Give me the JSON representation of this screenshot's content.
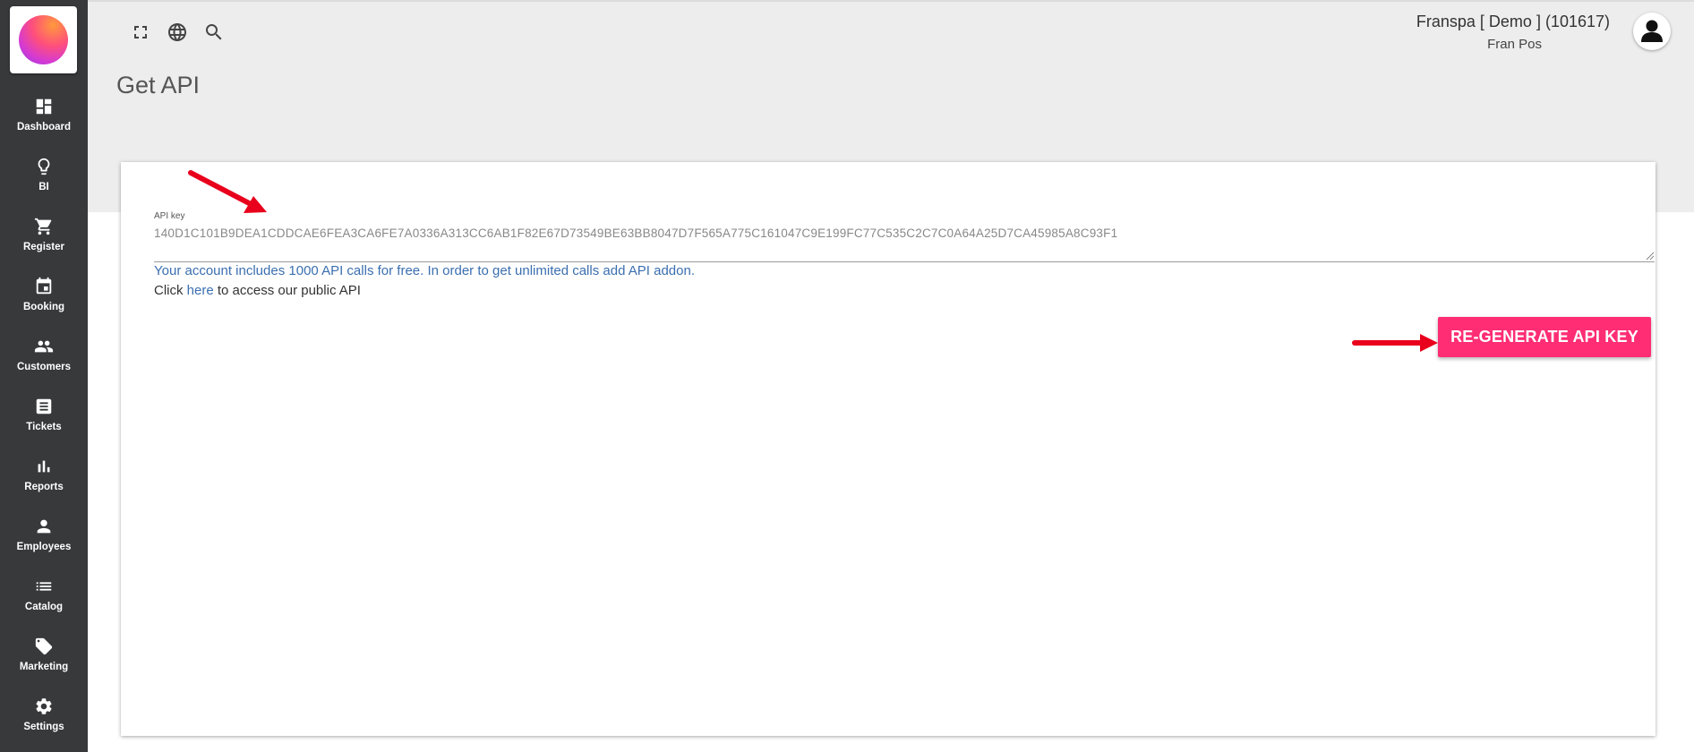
{
  "sidebar": {
    "logo": "company-logo",
    "items": [
      {
        "label": "Dashboard",
        "icon": "dashboard-icon"
      },
      {
        "label": "BI",
        "icon": "lightbulb-icon"
      },
      {
        "label": "Register",
        "icon": "cart-icon"
      },
      {
        "label": "Booking",
        "icon": "calendar-icon"
      },
      {
        "label": "Customers",
        "icon": "people-icon"
      },
      {
        "label": "Tickets",
        "icon": "receipt-icon"
      },
      {
        "label": "Reports",
        "icon": "bar-chart-icon"
      },
      {
        "label": "Employees",
        "icon": "person-icon"
      },
      {
        "label": "Catalog",
        "icon": "list-icon"
      },
      {
        "label": "Marketing",
        "icon": "tag-icon"
      },
      {
        "label": "Settings",
        "icon": "gear-icon"
      }
    ]
  },
  "header": {
    "title": "Get API",
    "tools": [
      "fullscreen-icon",
      "globe-icon",
      "search-icon"
    ],
    "account_name": "Franspa [ Demo ] (101617)",
    "account_sub": "Fran Pos"
  },
  "api": {
    "label": "API key",
    "key": "140D1C101B9DEA1CDDCAE6FEA3CA6FE7A0336A313CC6AB1F82E67D73549BE63BB8047D7F565A775C161047C9E199FC77C535C2C7C0A64A25D7CA45985A8C93F1",
    "info": "Your account includes 1000 API calls for free. In order to get unlimited calls add API addon.",
    "click_prefix": "Click ",
    "click_link": "here",
    "click_suffix": " to access our public API",
    "regenerate_label": "RE-GENERATE API KEY"
  },
  "colors": {
    "sidebar_bg": "#37393b",
    "header_bg": "#ededed",
    "accent": "#ff2d73",
    "link": "#3b6fb0",
    "annotation_arrow": "#e8001c"
  }
}
